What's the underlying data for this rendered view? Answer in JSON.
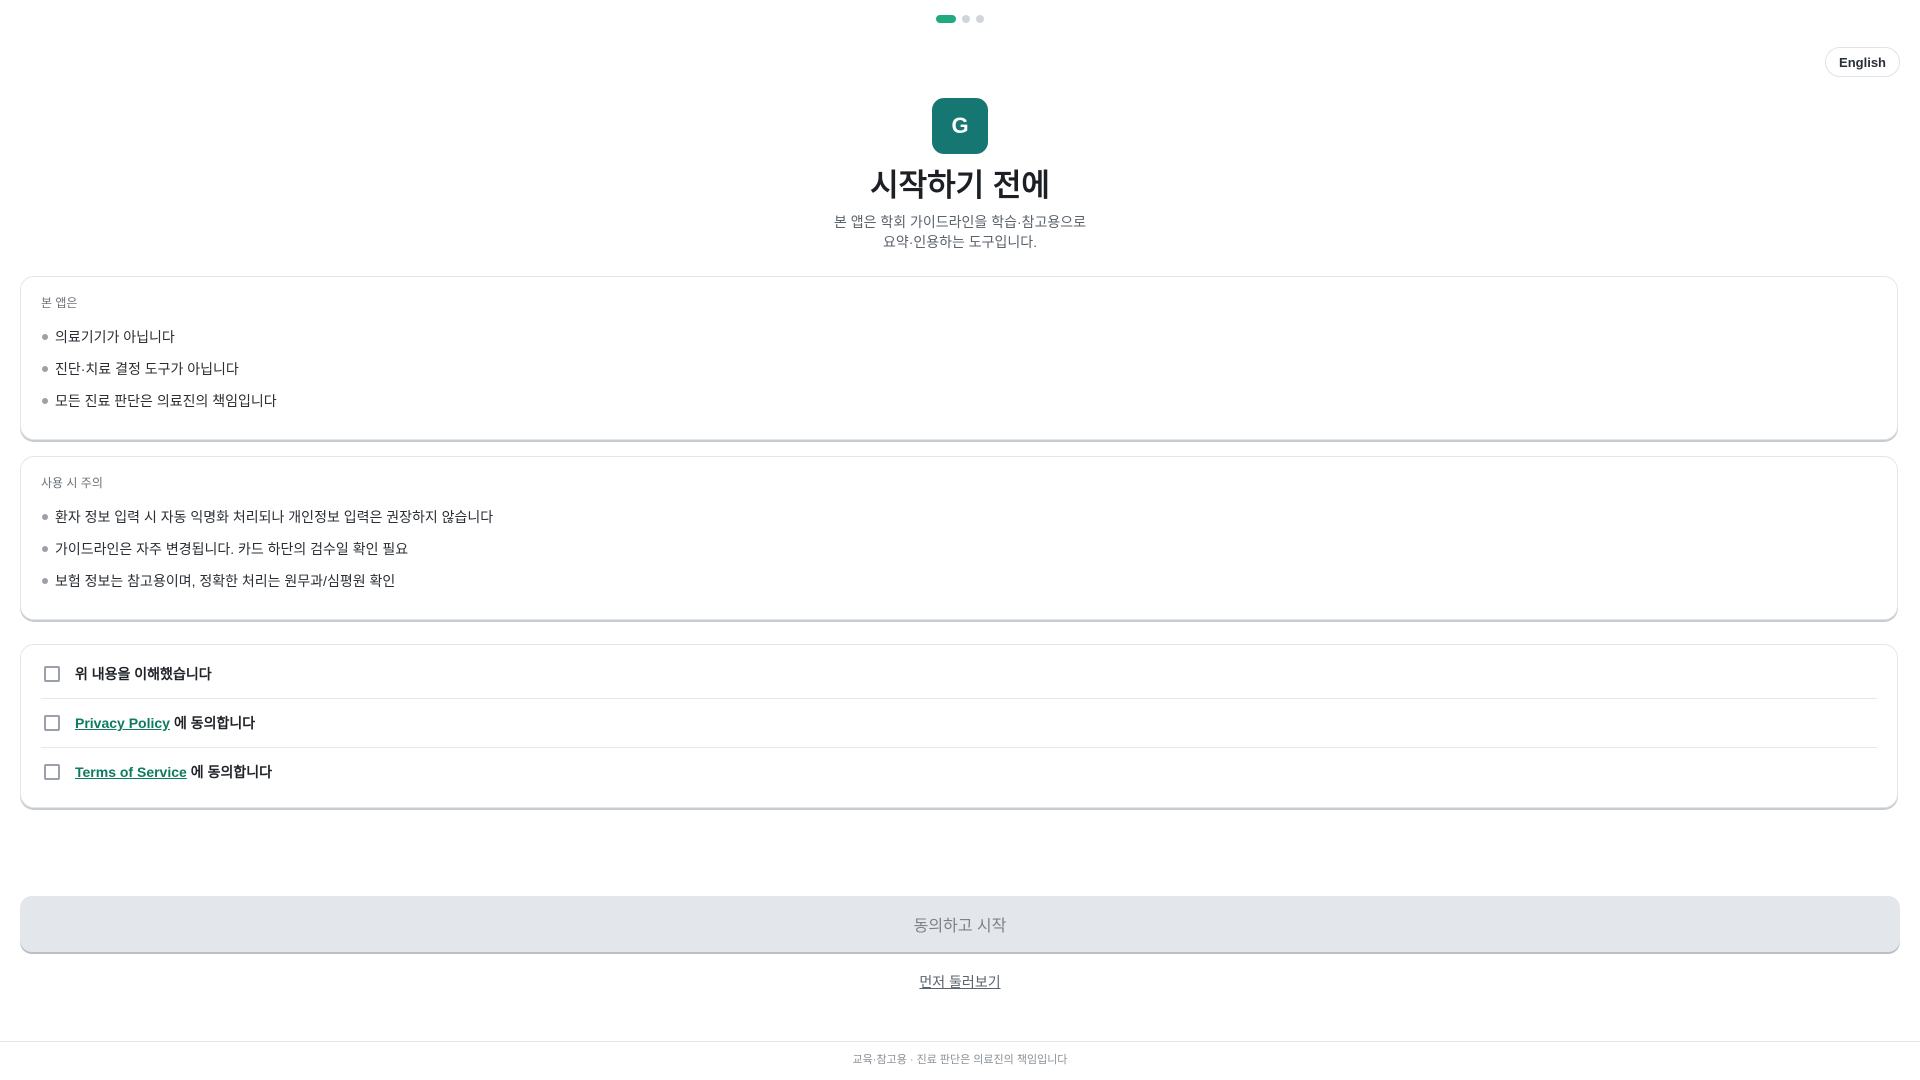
{
  "progress": {
    "steps": 3,
    "current": 1
  },
  "header": {
    "language_button": "English"
  },
  "logo": {
    "letter": "G",
    "color": "#167672"
  },
  "intro": {
    "title": "시작하기 전에",
    "subtitle_line1": "본 앱은 학회 가이드라인을 학습·참고용으로",
    "subtitle_line2": "요약·인용하는 도구입니다."
  },
  "about_card": {
    "heading": "본 앱은",
    "items": [
      "의료기기가 아닙니다",
      "진단·치료 결정 도구가 아닙니다",
      "모든 진료 판단은 의료진의 책임입니다"
    ]
  },
  "caution_card": {
    "heading": "사용 시 주의",
    "items": [
      "환자 정보 입력 시 자동 익명화 처리되나 개인정보 입력은 권장하지 않습니다",
      "가이드라인은 자주 변경됩니다. 카드 하단의 검수일 확인 필요",
      "보험 정보는 참고용이며, 정확한 처리는 원무과/심평원 확인"
    ]
  },
  "agreements": {
    "understood": {
      "label": "위 내용을 이해했습니다",
      "checked": false
    },
    "privacy": {
      "link": "Privacy Policy",
      "suffix": "에 동의합니다",
      "checked": false
    },
    "terms": {
      "link": "Terms of Service",
      "suffix": "에 동의합니다",
      "checked": false
    }
  },
  "actions": {
    "primary": "동의하고 시작",
    "primary_enabled": false,
    "secondary": "먼저 둘러보기"
  },
  "footer": {
    "text": "교육·참고용 · 진료 판단은 의료진의 책임입니다"
  },
  "colors": {
    "accent": "#1faa80",
    "link": "#0e7a5f",
    "disabled_button": "#e3e6ea"
  }
}
